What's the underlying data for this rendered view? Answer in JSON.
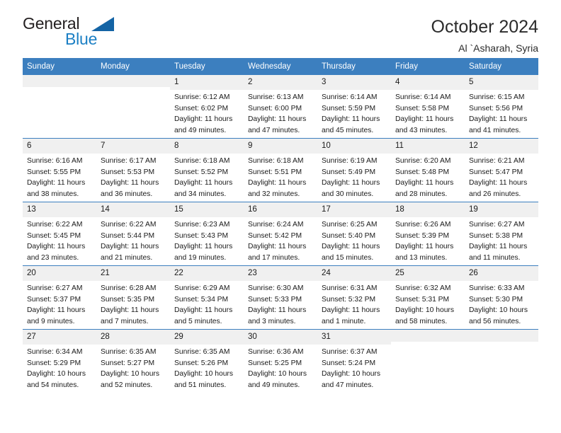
{
  "brand": {
    "name_part1": "General",
    "name_part2": "Blue",
    "triangle_color": "#1464a5",
    "blue_color": "#1b7fc4"
  },
  "header": {
    "title": "October 2024",
    "subtitle": "Al `Asharah, Syria",
    "header_bg": "#3c7fbf",
    "daynum_bg": "#f0f0f0"
  },
  "weekdays": [
    "Sunday",
    "Monday",
    "Tuesday",
    "Wednesday",
    "Thursday",
    "Friday",
    "Saturday"
  ],
  "weeks": [
    [
      {
        "day": "",
        "sunrise": "",
        "sunset": "",
        "daylight1": "",
        "daylight2": ""
      },
      {
        "day": "",
        "sunrise": "",
        "sunset": "",
        "daylight1": "",
        "daylight2": ""
      },
      {
        "day": "1",
        "sunrise": "Sunrise: 6:12 AM",
        "sunset": "Sunset: 6:02 PM",
        "daylight1": "Daylight: 11 hours",
        "daylight2": "and 49 minutes."
      },
      {
        "day": "2",
        "sunrise": "Sunrise: 6:13 AM",
        "sunset": "Sunset: 6:00 PM",
        "daylight1": "Daylight: 11 hours",
        "daylight2": "and 47 minutes."
      },
      {
        "day": "3",
        "sunrise": "Sunrise: 6:14 AM",
        "sunset": "Sunset: 5:59 PM",
        "daylight1": "Daylight: 11 hours",
        "daylight2": "and 45 minutes."
      },
      {
        "day": "4",
        "sunrise": "Sunrise: 6:14 AM",
        "sunset": "Sunset: 5:58 PM",
        "daylight1": "Daylight: 11 hours",
        "daylight2": "and 43 minutes."
      },
      {
        "day": "5",
        "sunrise": "Sunrise: 6:15 AM",
        "sunset": "Sunset: 5:56 PM",
        "daylight1": "Daylight: 11 hours",
        "daylight2": "and 41 minutes."
      }
    ],
    [
      {
        "day": "6",
        "sunrise": "Sunrise: 6:16 AM",
        "sunset": "Sunset: 5:55 PM",
        "daylight1": "Daylight: 11 hours",
        "daylight2": "and 38 minutes."
      },
      {
        "day": "7",
        "sunrise": "Sunrise: 6:17 AM",
        "sunset": "Sunset: 5:53 PM",
        "daylight1": "Daylight: 11 hours",
        "daylight2": "and 36 minutes."
      },
      {
        "day": "8",
        "sunrise": "Sunrise: 6:18 AM",
        "sunset": "Sunset: 5:52 PM",
        "daylight1": "Daylight: 11 hours",
        "daylight2": "and 34 minutes."
      },
      {
        "day": "9",
        "sunrise": "Sunrise: 6:18 AM",
        "sunset": "Sunset: 5:51 PM",
        "daylight1": "Daylight: 11 hours",
        "daylight2": "and 32 minutes."
      },
      {
        "day": "10",
        "sunrise": "Sunrise: 6:19 AM",
        "sunset": "Sunset: 5:49 PM",
        "daylight1": "Daylight: 11 hours",
        "daylight2": "and 30 minutes."
      },
      {
        "day": "11",
        "sunrise": "Sunrise: 6:20 AM",
        "sunset": "Sunset: 5:48 PM",
        "daylight1": "Daylight: 11 hours",
        "daylight2": "and 28 minutes."
      },
      {
        "day": "12",
        "sunrise": "Sunrise: 6:21 AM",
        "sunset": "Sunset: 5:47 PM",
        "daylight1": "Daylight: 11 hours",
        "daylight2": "and 26 minutes."
      }
    ],
    [
      {
        "day": "13",
        "sunrise": "Sunrise: 6:22 AM",
        "sunset": "Sunset: 5:45 PM",
        "daylight1": "Daylight: 11 hours",
        "daylight2": "and 23 minutes."
      },
      {
        "day": "14",
        "sunrise": "Sunrise: 6:22 AM",
        "sunset": "Sunset: 5:44 PM",
        "daylight1": "Daylight: 11 hours",
        "daylight2": "and 21 minutes."
      },
      {
        "day": "15",
        "sunrise": "Sunrise: 6:23 AM",
        "sunset": "Sunset: 5:43 PM",
        "daylight1": "Daylight: 11 hours",
        "daylight2": "and 19 minutes."
      },
      {
        "day": "16",
        "sunrise": "Sunrise: 6:24 AM",
        "sunset": "Sunset: 5:42 PM",
        "daylight1": "Daylight: 11 hours",
        "daylight2": "and 17 minutes."
      },
      {
        "day": "17",
        "sunrise": "Sunrise: 6:25 AM",
        "sunset": "Sunset: 5:40 PM",
        "daylight1": "Daylight: 11 hours",
        "daylight2": "and 15 minutes."
      },
      {
        "day": "18",
        "sunrise": "Sunrise: 6:26 AM",
        "sunset": "Sunset: 5:39 PM",
        "daylight1": "Daylight: 11 hours",
        "daylight2": "and 13 minutes."
      },
      {
        "day": "19",
        "sunrise": "Sunrise: 6:27 AM",
        "sunset": "Sunset: 5:38 PM",
        "daylight1": "Daylight: 11 hours",
        "daylight2": "and 11 minutes."
      }
    ],
    [
      {
        "day": "20",
        "sunrise": "Sunrise: 6:27 AM",
        "sunset": "Sunset: 5:37 PM",
        "daylight1": "Daylight: 11 hours",
        "daylight2": "and 9 minutes."
      },
      {
        "day": "21",
        "sunrise": "Sunrise: 6:28 AM",
        "sunset": "Sunset: 5:35 PM",
        "daylight1": "Daylight: 11 hours",
        "daylight2": "and 7 minutes."
      },
      {
        "day": "22",
        "sunrise": "Sunrise: 6:29 AM",
        "sunset": "Sunset: 5:34 PM",
        "daylight1": "Daylight: 11 hours",
        "daylight2": "and 5 minutes."
      },
      {
        "day": "23",
        "sunrise": "Sunrise: 6:30 AM",
        "sunset": "Sunset: 5:33 PM",
        "daylight1": "Daylight: 11 hours",
        "daylight2": "and 3 minutes."
      },
      {
        "day": "24",
        "sunrise": "Sunrise: 6:31 AM",
        "sunset": "Sunset: 5:32 PM",
        "daylight1": "Daylight: 11 hours",
        "daylight2": "and 1 minute."
      },
      {
        "day": "25",
        "sunrise": "Sunrise: 6:32 AM",
        "sunset": "Sunset: 5:31 PM",
        "daylight1": "Daylight: 10 hours",
        "daylight2": "and 58 minutes."
      },
      {
        "day": "26",
        "sunrise": "Sunrise: 6:33 AM",
        "sunset": "Sunset: 5:30 PM",
        "daylight1": "Daylight: 10 hours",
        "daylight2": "and 56 minutes."
      }
    ],
    [
      {
        "day": "27",
        "sunrise": "Sunrise: 6:34 AM",
        "sunset": "Sunset: 5:29 PM",
        "daylight1": "Daylight: 10 hours",
        "daylight2": "and 54 minutes."
      },
      {
        "day": "28",
        "sunrise": "Sunrise: 6:35 AM",
        "sunset": "Sunset: 5:27 PM",
        "daylight1": "Daylight: 10 hours",
        "daylight2": "and 52 minutes."
      },
      {
        "day": "29",
        "sunrise": "Sunrise: 6:35 AM",
        "sunset": "Sunset: 5:26 PM",
        "daylight1": "Daylight: 10 hours",
        "daylight2": "and 51 minutes."
      },
      {
        "day": "30",
        "sunrise": "Sunrise: 6:36 AM",
        "sunset": "Sunset: 5:25 PM",
        "daylight1": "Daylight: 10 hours",
        "daylight2": "and 49 minutes."
      },
      {
        "day": "31",
        "sunrise": "Sunrise: 6:37 AM",
        "sunset": "Sunset: 5:24 PM",
        "daylight1": "Daylight: 10 hours",
        "daylight2": "and 47 minutes."
      },
      {
        "day": "",
        "sunrise": "",
        "sunset": "",
        "daylight1": "",
        "daylight2": ""
      },
      {
        "day": "",
        "sunrise": "",
        "sunset": "",
        "daylight1": "",
        "daylight2": ""
      }
    ]
  ]
}
